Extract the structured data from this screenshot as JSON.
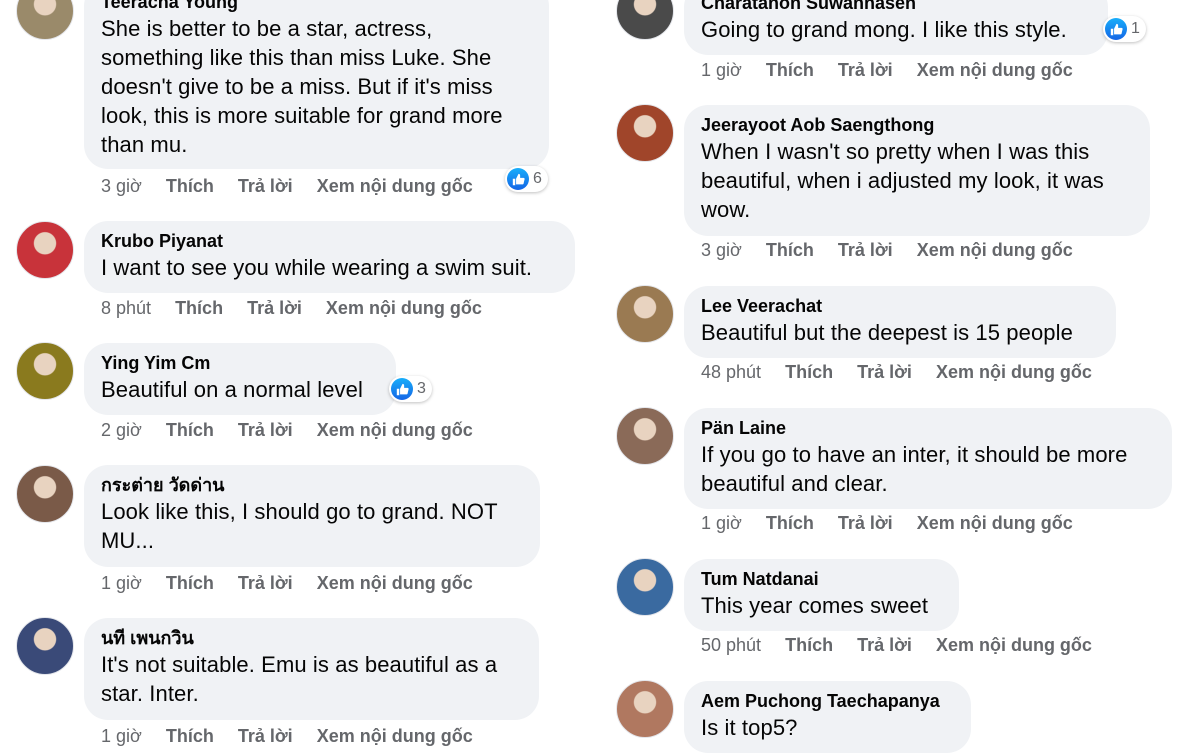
{
  "left": [
    {
      "author": "Teeracha Young",
      "lines": [
        "She is better to be a star, actress,",
        "something like this than miss Luke. She",
        "doesn't give to be a miss. But if it's miss",
        "look, this is more suitable for grand more",
        "than mu."
      ],
      "time": "3 giờ",
      "like": "Thích",
      "reply": "Trả lời",
      "see_original": "Xem nội dung gốc",
      "reactions": "6",
      "avatar_color": "#9a8a6a"
    },
    {
      "author": "Krubo Piyanat",
      "lines": [
        "I want to see you while wearing a swim suit."
      ],
      "time": "8 phút",
      "like": "Thích",
      "reply": "Trả lời",
      "see_original": "Xem nội dung gốc",
      "avatar_color": "#c8333a"
    },
    {
      "author": "Ying Yim Cm",
      "lines": [
        "Beautiful on a normal level"
      ],
      "time": "2 giờ",
      "like": "Thích",
      "reply": "Trả lời",
      "see_original": "Xem nội dung gốc",
      "reactions": "3",
      "avatar_color": "#8a7a1e"
    },
    {
      "author": "กระต่าย วัดด่าน",
      "lines": [
        "Look like this, I should go to grand. NOT",
        "MU..."
      ],
      "time": "1 giờ",
      "like": "Thích",
      "reply": "Trả lời",
      "see_original": "Xem nội dung gốc",
      "avatar_color": "#7a5a48"
    },
    {
      "author": "นที เพนกวิน",
      "lines": [
        "It's not suitable. Emu is as beautiful as a",
        "star. Inter."
      ],
      "time": "1 giờ",
      "like": "Thích",
      "reply": "Trả lời",
      "see_original": "Xem nội dung gốc",
      "avatar_color": "#3a4a78"
    }
  ],
  "right": [
    {
      "author": "Charatanon Suwannasen",
      "lines": [
        "Going to grand mong. I like this style."
      ],
      "time": "1 giờ",
      "like": "Thích",
      "reply": "Trả lời",
      "see_original": "Xem nội dung gốc",
      "reactions": "1",
      "avatar_color": "#4a4a4a"
    },
    {
      "author": "Jeerayoot Aob Saengthong",
      "lines": [
        "When I wasn't so pretty when I was this",
        "beautiful, when i adjusted my look, it was",
        "wow."
      ],
      "time": "3 giờ",
      "like": "Thích",
      "reply": "Trả lời",
      "see_original": "Xem nội dung gốc",
      "avatar_color": "#a0452a"
    },
    {
      "author": "Lee Veerachat",
      "lines": [
        "Beautiful but the deepest is 15 people"
      ],
      "time": "48 phút",
      "like": "Thích",
      "reply": "Trả lời",
      "see_original": "Xem nội dung gốc",
      "avatar_color": "#9a7a52"
    },
    {
      "author": "Pän Laine",
      "lines": [
        "If you go to have an inter, it should be more",
        "beautiful and clear."
      ],
      "time": "1 giờ",
      "like": "Thích",
      "reply": "Trả lời",
      "see_original": "Xem nội dung gốc",
      "avatar_color": "#8a6a58"
    },
    {
      "author": "Tum Natdanai",
      "lines": [
        "This year comes sweet"
      ],
      "time": "50 phút",
      "like": "Thích",
      "reply": "Trả lời",
      "see_original": "Xem nội dung gốc",
      "avatar_color": "#3a6aa0"
    },
    {
      "author": "Aem Puchong Taechapanya",
      "lines": [
        "Is it top5?"
      ],
      "time": "",
      "like": "",
      "reply": "",
      "see_original": "",
      "avatar_color": "#b07860"
    }
  ]
}
